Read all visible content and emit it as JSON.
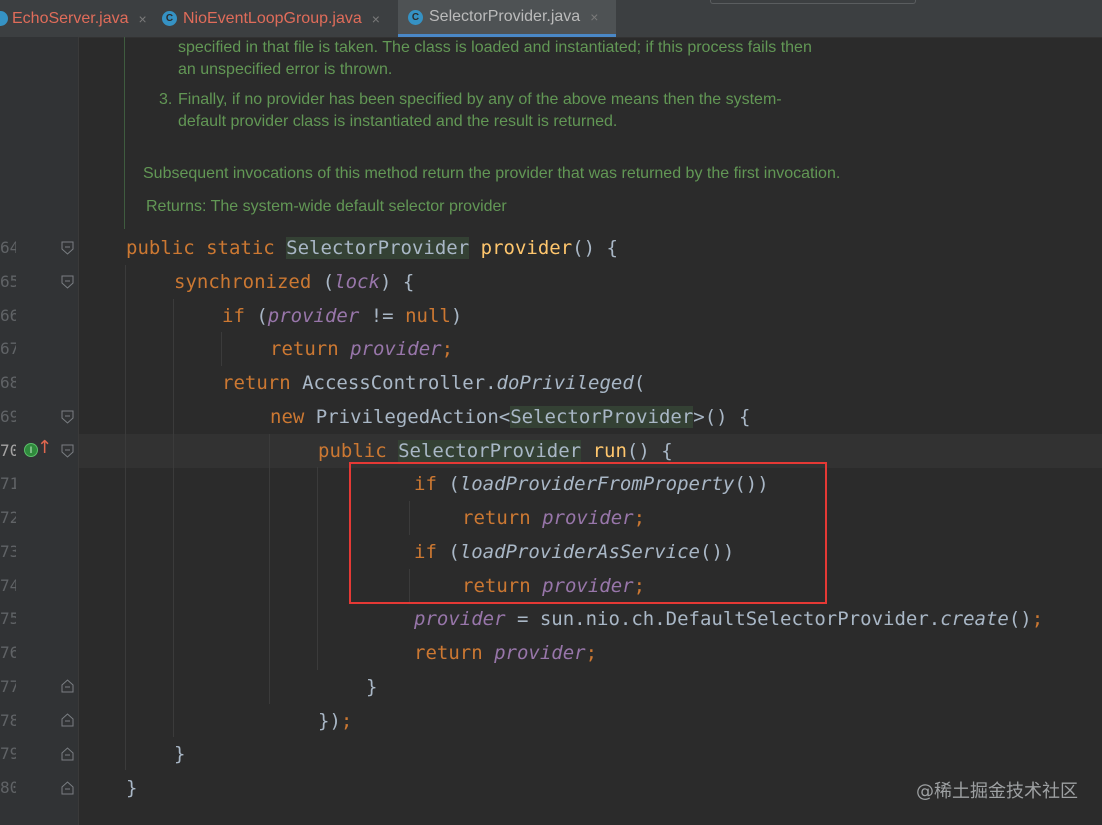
{
  "tabs": [
    {
      "label": "EchoServer.java",
      "close": "×"
    },
    {
      "label": "NioEventLoopGroup.java",
      "icon": "C",
      "close": "×"
    },
    {
      "label": "SelectorProvider.java",
      "icon": "C",
      "close": "×"
    }
  ],
  "doc": {
    "line1": "specified in that file is taken. The class is loaded and instantiated; if this process fails then",
    "line2": "an unspecified error is thrown.",
    "item3_num": "3.",
    "item3_line1": "Finally, if no provider has been specified by any of the above means then the system-",
    "item3_line2": "default provider class is instantiated and the result is returned.",
    "subsequent": "Subsequent invocations of this method return the provider that was returned by the first invocation.",
    "returns_label": "Returns:",
    "returns_text": "The system-wide default selector provider"
  },
  "line_numbers": [
    "64",
    "65",
    "66",
    "67",
    "68",
    "69",
    "70",
    "71",
    "72",
    "73",
    "74",
    "75",
    "76",
    "77",
    "78",
    "79",
    "80"
  ],
  "code": {
    "l64": {
      "kw": "public static ",
      "type": "SelectorProvider",
      "sp": " ",
      "fn": "provider",
      "rest": "() {"
    },
    "l65": {
      "kw": "synchronized ",
      "p1": "(",
      "fld": "lock",
      "p2": ") {"
    },
    "l66": {
      "kw": "if ",
      "p1": "(",
      "fld": "provider",
      "mid": " != ",
      "kw2": "null",
      "p2": ")"
    },
    "l67": {
      "kw": "return ",
      "fld": "provider",
      "semi": ";"
    },
    "l68": {
      "kw": "return ",
      "cls": "AccessController.",
      "st": "doPrivileged",
      "p": "("
    },
    "l69": {
      "kw": "new ",
      "cls": "PrivilegedAction<",
      "type": "SelectorProvider",
      "rest": ">() {"
    },
    "l70": {
      "kw": "public ",
      "type": "SelectorProvider",
      "sp": " ",
      "fn": "run",
      "rest": "() {"
    },
    "l71": {
      "kw": "if ",
      "p1": "(",
      "st": "loadProviderFromProperty",
      "p2": "())"
    },
    "l72": {
      "kw": "return ",
      "fld": "provider",
      "semi": ";"
    },
    "l73": {
      "kw": "if ",
      "p1": "(",
      "st": "loadProviderAsService",
      "p2": "())"
    },
    "l74": {
      "kw": "return ",
      "fld": "provider",
      "semi": ";"
    },
    "l75": {
      "fld": "provider",
      "mid": " = sun.nio.ch.DefaultSelectorProvider.",
      "st": "create",
      "p": "()",
      "semi": ";"
    },
    "l76": {
      "kw": "return ",
      "fld": "provider",
      "semi": ";"
    },
    "l77": {
      "brace": "}"
    },
    "l78": {
      "brace": "})",
      "semi": ";"
    },
    "l79": {
      "brace": "}"
    },
    "l80": {
      "brace": "}"
    }
  },
  "gutter": {
    "implements_icon": "I",
    "override_arrow": "↑"
  },
  "watermark": "@稀土掘金技术社区",
  "colors": {
    "background": "#2b2b2b",
    "keyword": "#cc7832",
    "field": "#9876aa",
    "method_decl": "#ffc66d",
    "doc_comment": "#629755",
    "highlight_box": "#e53935"
  }
}
